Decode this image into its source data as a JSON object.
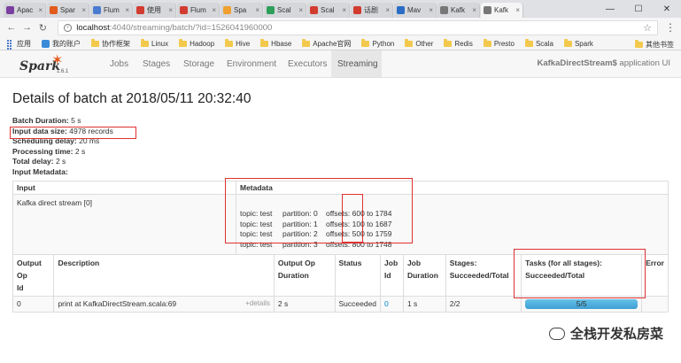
{
  "browser": {
    "tabs": [
      {
        "label": "Apac",
        "color": "#7a3ea0"
      },
      {
        "label": "Spar",
        "color": "#e25a1c"
      },
      {
        "label": "Flum",
        "color": "#4a7bd0"
      },
      {
        "label": "使用",
        "color": "#d23b2f"
      },
      {
        "label": "Flum",
        "color": "#d23b2f"
      },
      {
        "label": "Spa",
        "color": "#f0a030"
      },
      {
        "label": "Scal",
        "color": "#2e9e5b"
      },
      {
        "label": "Scal",
        "color": "#d23b2f"
      },
      {
        "label": "话剧",
        "color": "#d23b2f"
      },
      {
        "label": "Mav",
        "color": "#2b6cc4"
      },
      {
        "label": "Kafk",
        "color": "#777777"
      },
      {
        "label": "Kafk",
        "color": "#777777"
      }
    ],
    "url_host": "localhost",
    "url_path": ":4040/streaming/batch/?id=1526041960000",
    "bookmarks": [
      "应用",
      "我的账户",
      "协作框架",
      "Linux",
      "Hadoop",
      "Hive",
      "Hbase",
      "Apache官网",
      "Python",
      "Other",
      "Redis",
      "Presto",
      "Scala",
      "Spark"
    ],
    "other_bookmarks": "其他书签"
  },
  "navbar": {
    "logo_text": "Spark",
    "version": "1.6.1",
    "items": [
      "Jobs",
      "Stages",
      "Storage",
      "Environment",
      "Executors",
      "Streaming"
    ],
    "active": "Streaming",
    "app_name": "KafkaDirectStream$",
    "app_suffix": " application UI"
  },
  "page_title": "Details of batch at 2018/05/11 20:32:40",
  "summary": [
    {
      "label": "Batch Duration:",
      "value": " 5 s"
    },
    {
      "label": "Input data size:",
      "value": " 4978 records"
    },
    {
      "label": "Scheduling delay:",
      "value": " 20 ms"
    },
    {
      "label": "Processing time:",
      "value": " 2 s"
    },
    {
      "label": "Total delay:",
      "value": " 2 s"
    },
    {
      "label": "Input Metadata:",
      "value": ""
    }
  ],
  "metadata_table": {
    "headers": [
      "Input",
      "Metadata"
    ],
    "input": "Kafka direct stream [0]",
    "lines": [
      {
        "topic": "topic: test",
        "partition": "partition: 0",
        "offsets": "offsets: 600 to 1784"
      },
      {
        "topic": "topic: test",
        "partition": "partition: 1",
        "offsets": "offsets: 100 to 1687"
      },
      {
        "topic": "topic: test",
        "partition": "partition: 2",
        "offsets": "offsets: 500 to 1759"
      },
      {
        "topic": "topic: test",
        "partition": "partition: 3",
        "offsets": "offsets: 800 to 1748"
      }
    ]
  },
  "ops_table": {
    "headers": {
      "op_id_1": "Output Op",
      "op_id_2": "Id",
      "description": "Description",
      "duration_1": "Output Op",
      "duration_2": "Duration",
      "status": "Status",
      "job_id_1": "Job",
      "job_id_2": "Id",
      "job_duration_1": "Job",
      "job_duration_2": "Duration",
      "stages_1": "Stages:",
      "stages_2": "Succeeded/Total",
      "tasks_1": "Tasks (for all stages):",
      "tasks_2": "Succeeded/Total",
      "error": "Error"
    },
    "row": {
      "op_id": "0",
      "description": "print at KafkaDirectStream.scala:69",
      "details": "+details",
      "duration": "2 s",
      "status": "Succeeded",
      "job_id": "0",
      "job_duration": "1 s",
      "stages": "2/2",
      "tasks": "5/5",
      "tasks_fraction": 1.0,
      "error": ""
    }
  },
  "watermark": "全栈开发私房菜",
  "colors": {
    "accent": "#0088cc",
    "annotation": "#e03131",
    "spark_orange": "#e25a1c"
  }
}
